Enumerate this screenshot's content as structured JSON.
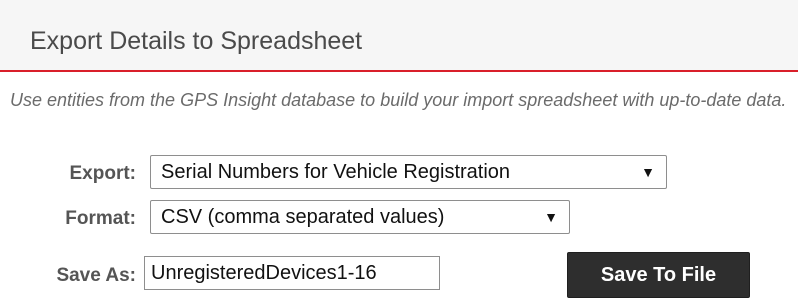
{
  "panel": {
    "title": "Export Details to Spreadsheet",
    "description": "Use entities from the GPS Insight database to build your import spreadsheet with up-to-date data."
  },
  "form": {
    "export": {
      "label": "Export:",
      "selected": "Serial Numbers for Vehicle Registration",
      "caret": "▼"
    },
    "format": {
      "label": "Format:",
      "selected": "CSV (comma separated values)",
      "caret": "▼"
    },
    "save_as": {
      "label": "Save As:",
      "value": "UnregisteredDevices1-16"
    },
    "save_button_label": "Save To File"
  },
  "colors": {
    "accent": "#d91f2a",
    "button": "#2e2e2e"
  }
}
